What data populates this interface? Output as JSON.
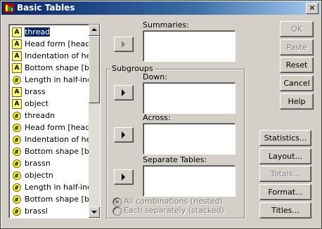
{
  "window": {
    "title": "Basic Tables",
    "close_glyph": "✕"
  },
  "variables": [
    {
      "label": "thread",
      "type": "string",
      "selected": true
    },
    {
      "label": "Head form [head]",
      "type": "string"
    },
    {
      "label": "Indentation of head",
      "type": "string"
    },
    {
      "label": "Bottom shape [botte",
      "type": "string"
    },
    {
      "label": "Length in half-inche",
      "type": "numeric"
    },
    {
      "label": "brass",
      "type": "string"
    },
    {
      "label": "object",
      "type": "string"
    },
    {
      "label": "threadn",
      "type": "numeric"
    },
    {
      "label": "Head form [headn]",
      "type": "numeric"
    },
    {
      "label": "Indentation of head",
      "type": "numeric"
    },
    {
      "label": "Bottom shape [botte",
      "type": "numeric"
    },
    {
      "label": "brassn",
      "type": "numeric"
    },
    {
      "label": "objectn",
      "type": "numeric"
    },
    {
      "label": "Length in half-inche",
      "type": "numeric"
    },
    {
      "label": "Bottom shape [botte",
      "type": "numeric"
    },
    {
      "label": "brassl",
      "type": "numeric"
    }
  ],
  "icons": {
    "string": "A",
    "numeric": "#"
  },
  "summaries": {
    "label": "Summaries:"
  },
  "subgroups": {
    "label": "Subgroups",
    "down_label": "Down:",
    "across_label": "Across:",
    "separate_label": "Separate Tables:"
  },
  "radios": {
    "all_combinations": "All combinations (nested)",
    "each_separately": "Each separately (stacked)"
  },
  "buttons": {
    "ok": "OK",
    "paste": "Paste",
    "reset": "Reset",
    "cancel": "Cancel",
    "help": "Help",
    "statistics": "Statistics...",
    "layout": "Layout...",
    "totals": "Totals...",
    "format": "Format...",
    "titles": "Titles..."
  }
}
